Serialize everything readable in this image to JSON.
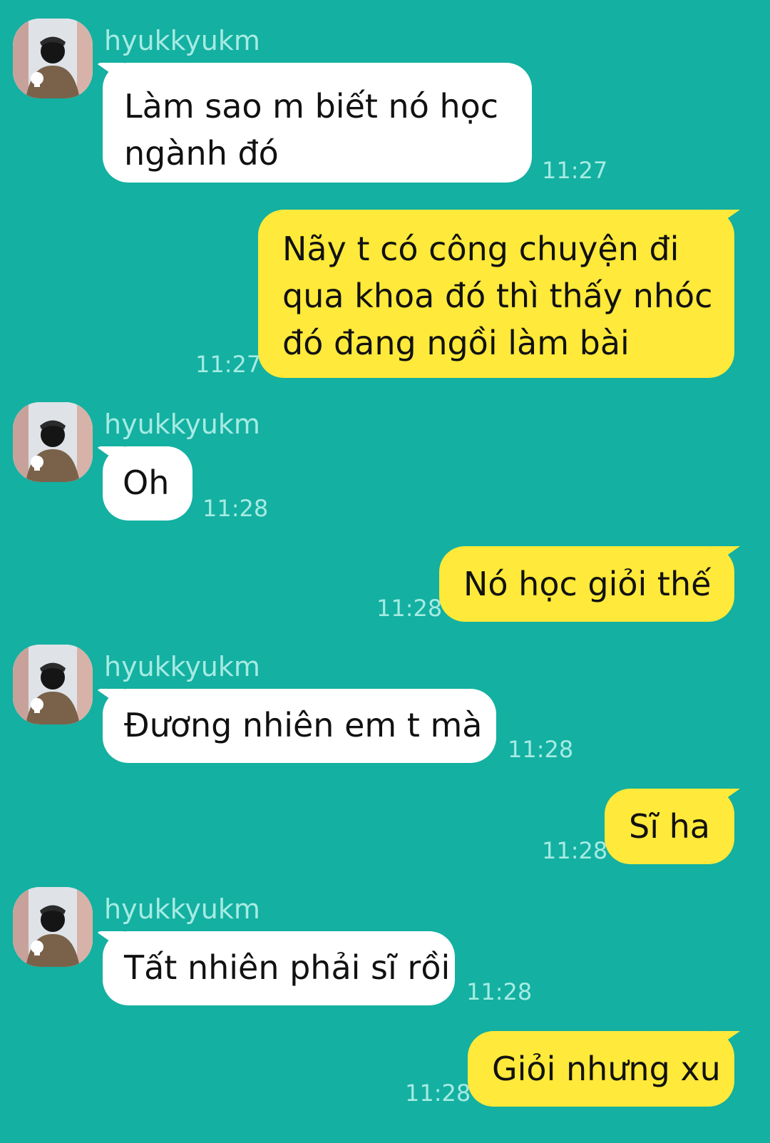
{
  "messages": [
    {
      "direction": "incoming",
      "sender": "hyukkyukm",
      "avatar_icon": "user-avatar-icon",
      "text": "Làm sao m biết nó học\nngành đó",
      "time": "11:27"
    },
    {
      "direction": "outgoing",
      "text": "Nãy t có công chuyện đi\nqua khoa đó thì thấy nhóc\nđó đang ngồi làm bài",
      "time": "11:27"
    },
    {
      "direction": "incoming",
      "sender": "hyukkyukm",
      "avatar_icon": "user-avatar-icon",
      "text": "Oh",
      "time": "11:28"
    },
    {
      "direction": "outgoing",
      "text": "Nó học giỏi thế",
      "time": "11:28"
    },
    {
      "direction": "incoming",
      "sender": "hyukkyukm",
      "avatar_icon": "user-avatar-icon",
      "text": "Đương nhiên em t mà",
      "time": "11:28"
    },
    {
      "direction": "outgoing",
      "text": "Sĩ ha",
      "time": "11:28"
    },
    {
      "direction": "incoming",
      "sender": "hyukkyukm",
      "avatar_icon": "user-avatar-icon",
      "text": "Tất nhiên phải sĩ rồi",
      "time": "11:28"
    },
    {
      "direction": "outgoing",
      "text": "Giỏi nhưng xu",
      "time": "11:28"
    }
  ],
  "colors": {
    "background": "#14b0a1",
    "incoming_bubble": "#ffffff",
    "outgoing_bubble": "#ffe93a",
    "meta_text": "#a6ebe3"
  }
}
